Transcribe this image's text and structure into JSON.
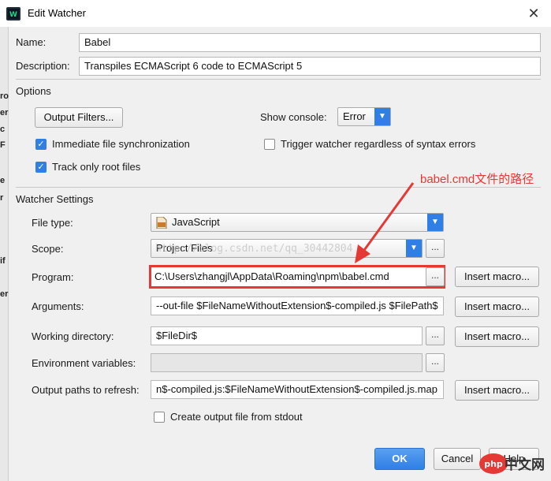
{
  "window": {
    "title": "Edit Watcher",
    "close_glyph": "✕"
  },
  "left_strip_glyphs": [
    "ro",
    "er",
    "c",
    "F",
    "e",
    "r",
    "if",
    "er"
  ],
  "name": {
    "label": "Name:",
    "value": "Babel"
  },
  "description": {
    "label": "Description:",
    "value": "Transpiles ECMAScript 6 code to ECMAScript 5"
  },
  "options": {
    "section_label": "Options",
    "output_filters_label": "Output Filters...",
    "show_console_label": "Show console:",
    "show_console_value": "Error",
    "immediate_sync_label": "Immediate file synchronization",
    "immediate_sync_checked": true,
    "trigger_label": "Trigger watcher regardless of syntax errors",
    "trigger_checked": false,
    "track_root_label": "Track only root files",
    "track_root_checked": true
  },
  "watcher_settings": {
    "section_label": "Watcher Settings",
    "file_type_label": "File type:",
    "file_type_value": "JavaScript",
    "file_type_icon_text": "JS",
    "scope_label": "Scope:",
    "scope_value": "Project Files",
    "program_label": "Program:",
    "program_value": "C:\\Users\\zhangjl\\AppData\\Roaming\\npm\\babel.cmd",
    "arguments_label": "Arguments:",
    "arguments_value": "--out-file $FileNameWithoutExtension$-compiled.js $FilePath$",
    "working_dir_label": "Working directory:",
    "working_dir_value": "$FileDir$",
    "env_label": "Environment variables:",
    "env_value": "",
    "output_paths_label": "Output paths to refresh:",
    "output_paths_value": "n$-compiled.js:$FileNameWithoutExtension$-compiled.js.map",
    "create_output_label": "Create output file from stdout",
    "create_output_checked": false,
    "insert_macro_label": "Insert macro...",
    "browse_label": "..."
  },
  "footer": {
    "ok_label": "OK",
    "cancel_label": "Cancel",
    "help_label": "Help"
  },
  "overlay": {
    "annotation_text": "babel.cmd文件的路径",
    "watermark_text": "http://blog.csdn.net/qq_30442804",
    "badge_logo_text": "php",
    "badge_text": "中文网"
  },
  "colors": {
    "accent": "#2f7fe6",
    "annotation": "#e53935"
  },
  "icons": [
    "webstorm-app-icon",
    "close-icon",
    "checkbox-checked-icon",
    "dropdown-arrow-icon",
    "js-file-icon",
    "annotation-arrow-icon"
  ]
}
